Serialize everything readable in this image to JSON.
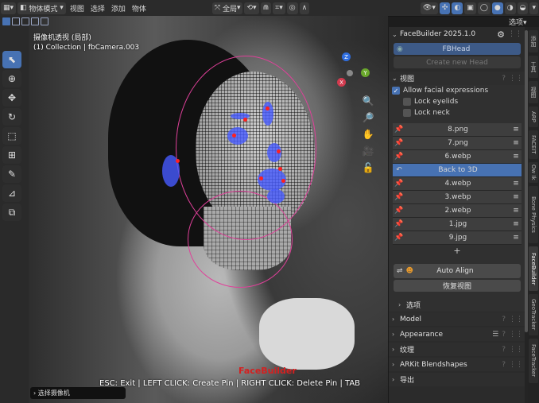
{
  "topbar": {
    "mode": "物体模式",
    "menus": [
      "视图",
      "选择",
      "添加",
      "物体"
    ],
    "transform": "全局",
    "options": "选项"
  },
  "viewport": {
    "view_name": "摄像机透视 (局部)",
    "collection": "(1) Collection | fbCamera.003"
  },
  "overlay": {
    "title": "FaceBuilder",
    "help": "ESC: Exit | LEFT CLICK: Create Pin | RIGHT CLICK: Delete Pin | TAB",
    "hint": "选择摄像机"
  },
  "panel": {
    "header": "FaceBuilder 2025.1.0",
    "head_button": "FBHead",
    "create_button": "Create new Head",
    "view_section": "视图",
    "allow_facial": "Allow facial expressions",
    "lock_eyelids": "Lock eyelids",
    "lock_neck": "Lock neck",
    "images": [
      {
        "label": "8.png",
        "active": false
      },
      {
        "label": "7.png",
        "active": false
      },
      {
        "label": "6.webp",
        "active": false
      },
      {
        "label": "Back to 3D",
        "active": true
      },
      {
        "label": "4.webp",
        "active": false
      },
      {
        "label": "3.webp",
        "active": false
      },
      {
        "label": "2.webp",
        "active": false
      },
      {
        "label": "1.jpg",
        "active": false
      },
      {
        "label": "9.jpg",
        "active": false
      }
    ],
    "add_symbol": "+",
    "auto_align": "Auto Align",
    "restore_view": "恢复视图",
    "options_sub": "选项",
    "sections": [
      "Model",
      "Appearance",
      "纹理",
      "ARKit Blendshapes",
      "导出"
    ]
  },
  "vtabs": [
    {
      "label": "添加",
      "on": false
    },
    {
      "label": "工具",
      "on": false
    },
    {
      "label": "视图",
      "on": false
    },
    {
      "label": "ARP",
      "on": false
    },
    {
      "label": "FACEIT",
      "on": false
    },
    {
      "label": "Ow Ik",
      "on": false
    },
    {
      "label": "Bone Physics",
      "on": false
    },
    {
      "label": "FaceBuilder",
      "on": true
    },
    {
      "label": "GeoTracker",
      "on": false
    },
    {
      "label": "FaceTracker",
      "on": false
    }
  ],
  "colors": {
    "accent": "#4772b3",
    "pin": "#ff2020",
    "overlay_title": "#d42020"
  }
}
